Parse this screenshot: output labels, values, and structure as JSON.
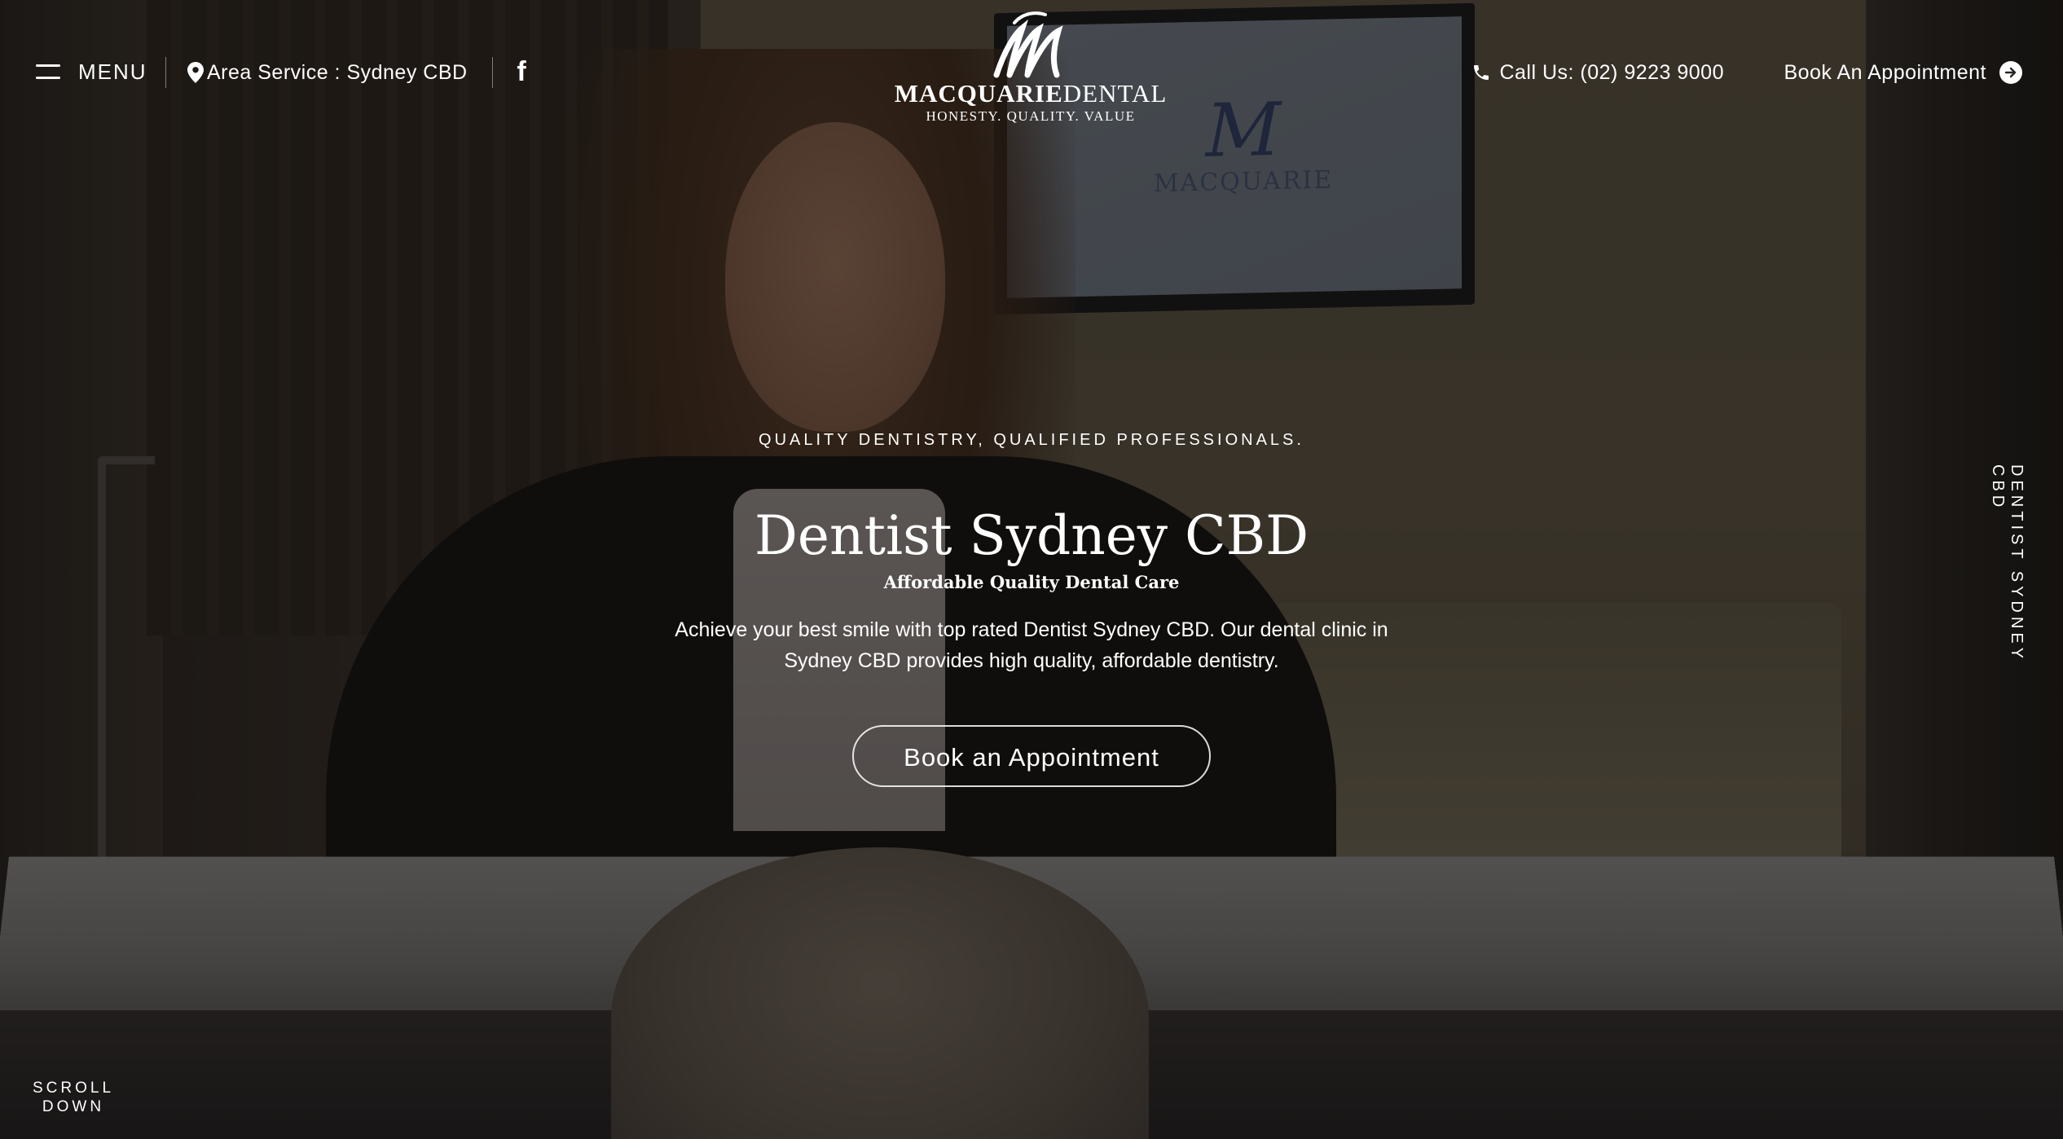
{
  "header": {
    "menu_label": "MENU",
    "area_service": "Area Service : Sydney CBD",
    "facebook_glyph": "f",
    "call_label": "Call Us: (02) 9223 9000",
    "book_label": "Book An Appointment"
  },
  "logo": {
    "name_part1": "MACQUARIE",
    "name_part2": "DENTAL",
    "tagline": "HONESTY. QUALITY. VALUE"
  },
  "hero": {
    "eyebrow": "QUALITY DENTISTRY, QUALIFIED PROFESSIONALS.",
    "title": "Dentist Sydney CBD",
    "subtitle": "Affordable Quality Dental Care",
    "description": "Achieve your best smile with top rated Dentist Sydney CBD. Our dental clinic in Sydney CBD provides high quality, affordable dentistry.",
    "cta_label": "Book an Appointment"
  },
  "side_text": "DENTIST SYDNEY CBD",
  "scroll": {
    "line1": "SCROLL",
    "line2": "DOWN"
  },
  "icons": {
    "menu": "hamburger-icon",
    "location": "map-pin-icon",
    "social": "facebook-icon",
    "phone": "phone-icon",
    "arrow": "arrow-right-circle-icon"
  },
  "colors": {
    "text": "#ffffff",
    "overlay": "#0c0a08"
  }
}
